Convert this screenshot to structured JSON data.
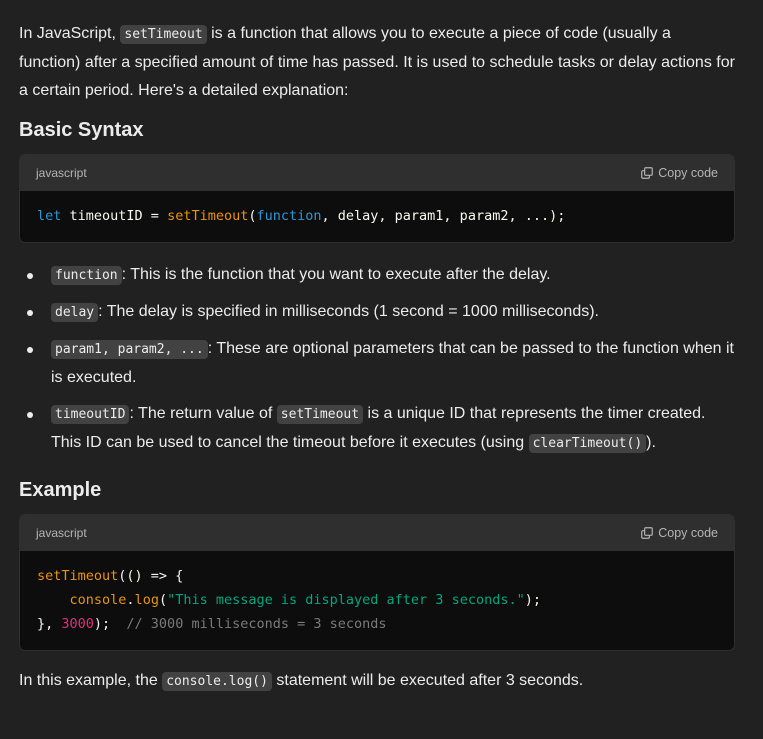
{
  "intro": {
    "pre": "In JavaScript, ",
    "code": "setTimeout",
    "post": " is a function that allows you to execute a piece of code (usually a function) after a specified amount of time has passed. It is used to schedule tasks or delay actions for a certain period. Here's a detailed explanation:"
  },
  "syntax_section": {
    "heading": "Basic Syntax",
    "code_block": {
      "language": "javascript",
      "copy_label": "Copy code",
      "tokens": {
        "t1": "let",
        "t2": " timeoutID = ",
        "t3": "setTimeout",
        "t4": "(",
        "t5": "function",
        "t6": ", delay, param1, param2, ...);"
      }
    }
  },
  "bullets": [
    {
      "code": "function",
      "text": ": This is the function that you want to execute after the delay."
    },
    {
      "code": "delay",
      "text": ": The delay is specified in milliseconds (1 second = 1000 milliseconds)."
    },
    {
      "code": "param1, param2, ...",
      "text": ": These are optional parameters that can be passed to the function when it is executed."
    },
    {
      "code": "timeoutID",
      "text_a": ": The return value of ",
      "code2": "setTimeout",
      "text_b": " is a unique ID that represents the timer created. This ID can be used to cancel the timeout before it executes (using ",
      "code3": "clearTimeout()",
      "text_c": ")."
    }
  ],
  "example_section": {
    "heading": "Example",
    "code_block": {
      "language": "javascript",
      "copy_label": "Copy code",
      "tokens": {
        "l1a": "setTimeout",
        "l1b": "(() => {",
        "l2indent": "    ",
        "l2a": "console",
        "l2b": ".",
        "l2c": "log",
        "l2d": "(",
        "l2e": "\"This message is displayed after 3 seconds.\"",
        "l2f": ");",
        "l3a": "}, ",
        "l3b": "3000",
        "l3c": ");  ",
        "l3d": "// 3000 milliseconds = 3 seconds"
      }
    }
  },
  "closing": {
    "pre": "In this example, the ",
    "code": "console.log()",
    "post": " statement will be executed after 3 seconds."
  },
  "colors": {
    "background": "#212121",
    "code_header": "#2f2f2f",
    "code_body": "#0d0d0d",
    "keyword": "#2e95d3",
    "function": "#f22c3d",
    "string": "#00a67d",
    "number": "#df3079",
    "comment": "#7a7a7a"
  },
  "icons": {
    "copy": "copy-icon"
  }
}
